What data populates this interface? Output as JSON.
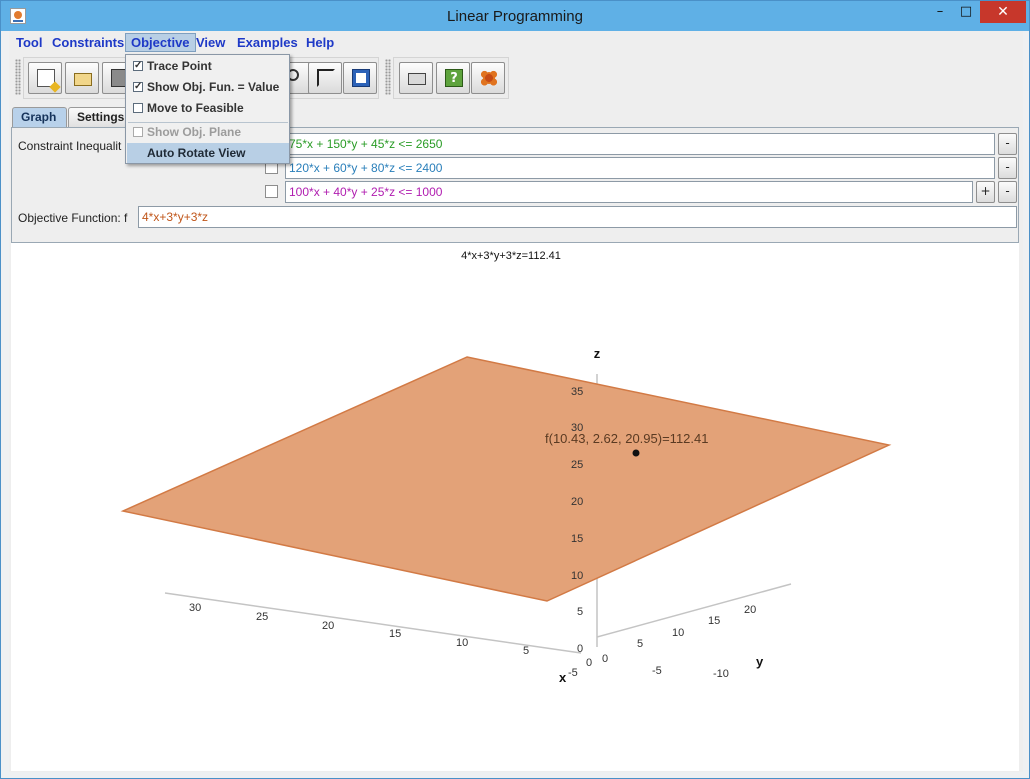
{
  "window": {
    "title": "Linear Programming",
    "minimize": "–",
    "maximize": "□",
    "close": "✕"
  },
  "menu": [
    "Tool",
    "Constraints",
    "Objective",
    "View",
    "Examples",
    "Help"
  ],
  "objective_menu": {
    "items": [
      {
        "label": "Trace Point",
        "checked": true,
        "enabled": true
      },
      {
        "label": "Show Obj. Fun. = Value",
        "checked": true,
        "enabled": true
      },
      {
        "label": "Move to Feasible",
        "checked": false,
        "enabled": true
      },
      {
        "label": "Show Obj. Plane",
        "checked": false,
        "enabled": false
      },
      {
        "label": "Auto Rotate View",
        "checked": null,
        "enabled": true
      }
    ]
  },
  "toolbar": {
    "icons": [
      "new-file-icon",
      "open-folder-icon",
      "save-disk-icon",
      "zoom-icon",
      "crop-icon",
      "table-icon",
      "print-icon",
      "help-icon",
      "about-flower-icon"
    ]
  },
  "tabs": [
    "Graph",
    "Settings"
  ],
  "constraints": {
    "label": "Constraint Inequalit",
    "rows": [
      {
        "text": "75*x + 150*y + 45*z <= 2650",
        "color": "#2a9c26"
      },
      {
        "text": "120*x + 60*y + 80*z <= 2400",
        "color": "#2a7fba"
      },
      {
        "text": "100*x + 40*y + 25*z <= 1000",
        "color": "#b01db0"
      }
    ],
    "remove": "-",
    "add": "+"
  },
  "objective": {
    "label": "Objective Function: f",
    "value": "4*x+3*y+3*z",
    "color": "#c0561a"
  },
  "graph": {
    "caption": "4*x+3*y+3*z=112.41",
    "point_label": "f(10.43, 2.62, 20.95)=112.41",
    "axis_labels": {
      "x": "x",
      "y": "y",
      "z": "z"
    },
    "x_ticks": [
      "30",
      "25",
      "20",
      "15",
      "10",
      "5",
      "0",
      "-5"
    ],
    "y_ticks": [
      "20",
      "15",
      "10",
      "5",
      "0",
      "-5",
      "-10"
    ],
    "z_ticks": [
      "35",
      "30",
      "25",
      "20",
      "15",
      "10",
      "5",
      "0"
    ],
    "plane_color": "#e3a278",
    "plane_edge": "#d27a45"
  }
}
